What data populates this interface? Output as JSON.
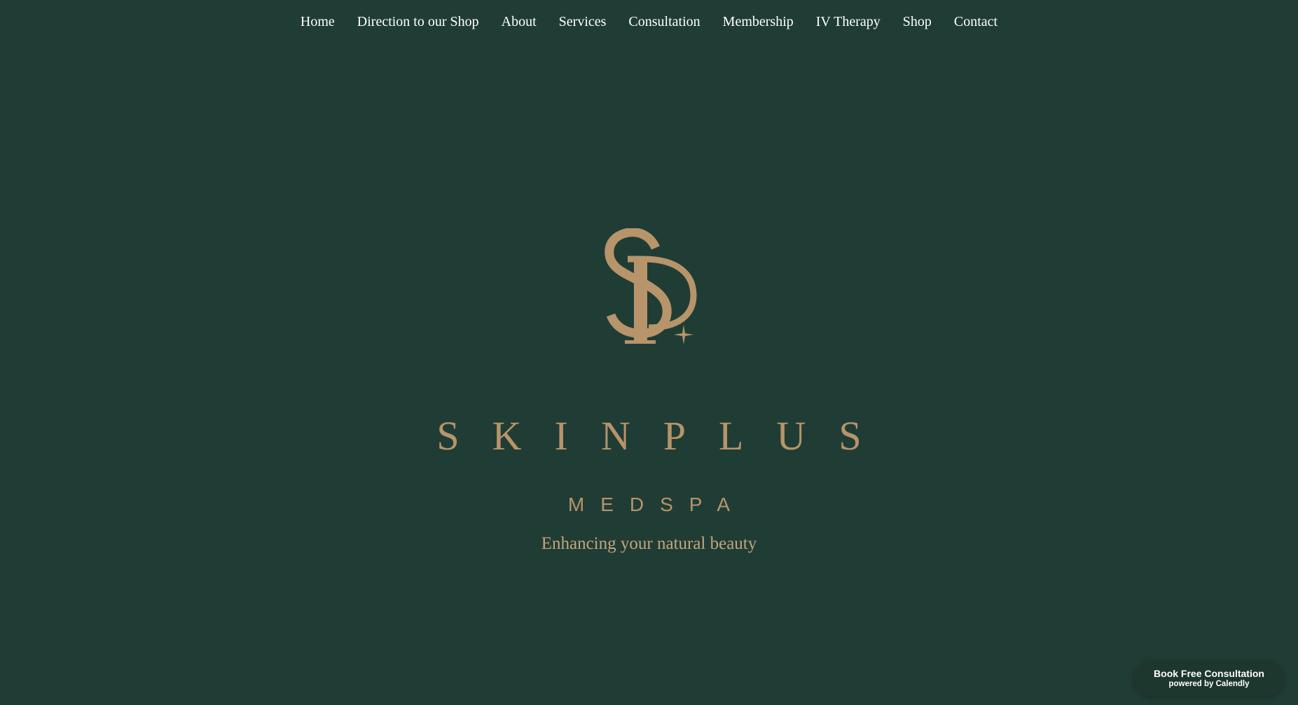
{
  "colors": {
    "background": "#203d35",
    "gold": "#b7946a",
    "nav_text": "#ffffff"
  },
  "nav": {
    "items": [
      {
        "label": "Home"
      },
      {
        "label": "Direction to our Shop"
      },
      {
        "label": "About"
      },
      {
        "label": "Services"
      },
      {
        "label": "Consultation"
      },
      {
        "label": "Membership"
      },
      {
        "label": "IV Therapy"
      },
      {
        "label": "Shop"
      },
      {
        "label": "Contact"
      }
    ]
  },
  "hero": {
    "logo_monogram": "SP",
    "logo_icon": "sparkle-icon",
    "brand_name": "SKINPLUS",
    "brand_sub": "MEDSPA",
    "tagline": "Enhancing your natural beauty"
  },
  "calendly": {
    "title": "Book Free Consultation",
    "powered": "powered by Calendly"
  }
}
